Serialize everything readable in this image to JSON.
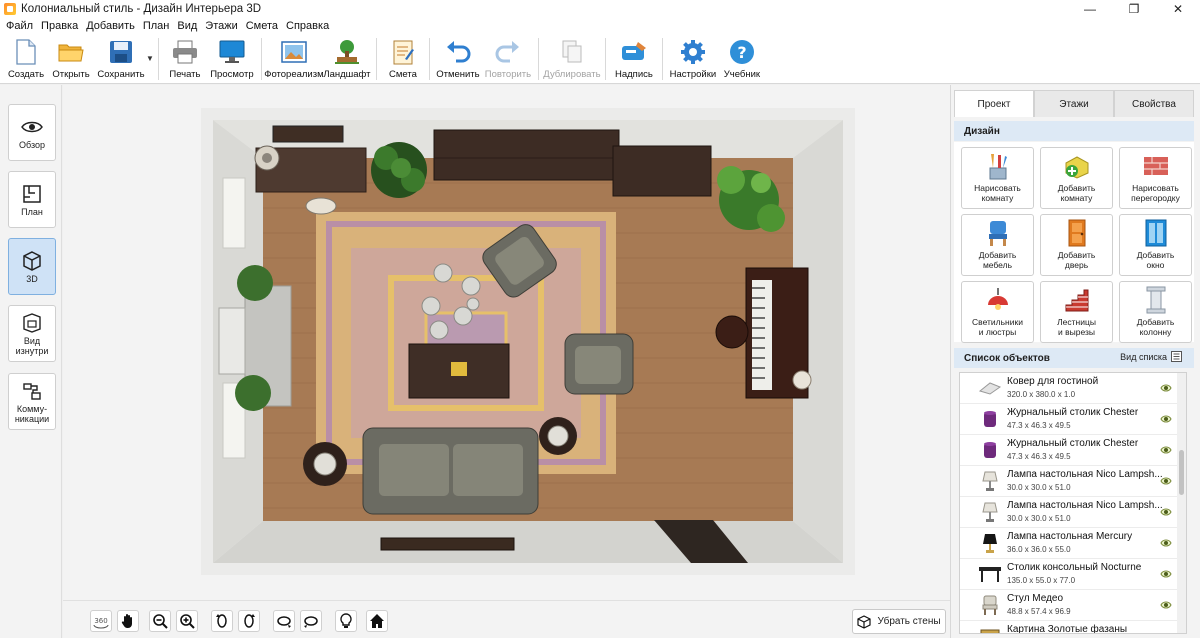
{
  "window": {
    "title": "Колониальный стиль - Дизайн Интерьера 3D",
    "controls": [
      "—",
      "❐",
      "✕"
    ]
  },
  "menu": [
    "Файл",
    "Правка",
    "Добавить",
    "План",
    "Вид",
    "Этажи",
    "Смета",
    "Справка"
  ],
  "toolbar": {
    "create": "Создать",
    "open": "Открыть",
    "save": "Сохранить",
    "print": "Печать",
    "preview": "Просмотр",
    "photoreal": "Фотореализм",
    "landscape": "Ландшафт",
    "estimate": "Смета",
    "undo": "Отменить",
    "redo": "Повторить",
    "duplicate": "Дублировать",
    "caption": "Надпись",
    "settings": "Настройки",
    "tutorial": "Учебник"
  },
  "views": [
    {
      "label": "Обзор",
      "active": false
    },
    {
      "label": "План",
      "active": false
    },
    {
      "label": "3D",
      "active": true
    },
    {
      "label": "Вид изнутри",
      "active": false
    },
    {
      "label": "Комму-никации",
      "active": false
    }
  ],
  "bottom": {
    "badge_360": "360",
    "remove_walls": "Убрать стены"
  },
  "right": {
    "tabs": [
      {
        "label": "Проект",
        "active": true
      },
      {
        "label": "Этажи",
        "active": false
      },
      {
        "label": "Свойства",
        "active": false
      }
    ],
    "design_title": "Дизайн",
    "design_buttons": [
      {
        "label1": "Нарисовать",
        "label2": "комнату",
        "icon": "pencils-icon"
      },
      {
        "label1": "Добавить",
        "label2": "комнату",
        "icon": "add-room-icon"
      },
      {
        "label1": "Нарисовать",
        "label2": "перегородку",
        "icon": "brick-wall-icon"
      },
      {
        "label1": "Добавить",
        "label2": "мебель",
        "icon": "chair-icon"
      },
      {
        "label1": "Добавить",
        "label2": "дверь",
        "icon": "door-icon"
      },
      {
        "label1": "Добавить",
        "label2": "окно",
        "icon": "window-icon"
      },
      {
        "label1": "Светильники",
        "label2": "и люстры",
        "icon": "lamp-icon"
      },
      {
        "label1": "Лестницы",
        "label2": "и вырезы",
        "icon": "stairs-icon"
      },
      {
        "label1": "Добавить",
        "label2": "колонну",
        "icon": "column-icon"
      }
    ],
    "objects_title": "Список объектов",
    "list_view": "Вид списка",
    "objects": [
      {
        "name": "Ковер для гостиной",
        "dims": "320.0 x 380.0 x 1.0",
        "icon": "rug-icon"
      },
      {
        "name": "Журнальный столик Chester",
        "dims": "47.3 x 46.3 x 49.5",
        "icon": "stool-icon"
      },
      {
        "name": "Журнальный столик Chester",
        "dims": "47.3 x 46.3 x 49.5",
        "icon": "stool-icon"
      },
      {
        "name": "Лампа настольная Nico Lampsh...",
        "dims": "30.0 x 30.0 x 51.0",
        "icon": "table-lamp-icon"
      },
      {
        "name": "Лампа настольная Nico Lampsh...",
        "dims": "30.0 x 30.0 x 51.0",
        "icon": "table-lamp-icon"
      },
      {
        "name": "Лампа настольная Mercury",
        "dims": "36.0 x 36.0 x 55.0",
        "icon": "black-lamp-icon"
      },
      {
        "name": "Столик консольный Nocturne",
        "dims": "135.0 x 55.0 x 77.0",
        "icon": "console-table-icon"
      },
      {
        "name": "Стул Медео",
        "dims": "48.8 x 57.4 x 96.9",
        "icon": "chair-icon"
      },
      {
        "name": "Картина Золотые фазаны",
        "dims": "",
        "icon": "picture-icon"
      }
    ]
  }
}
